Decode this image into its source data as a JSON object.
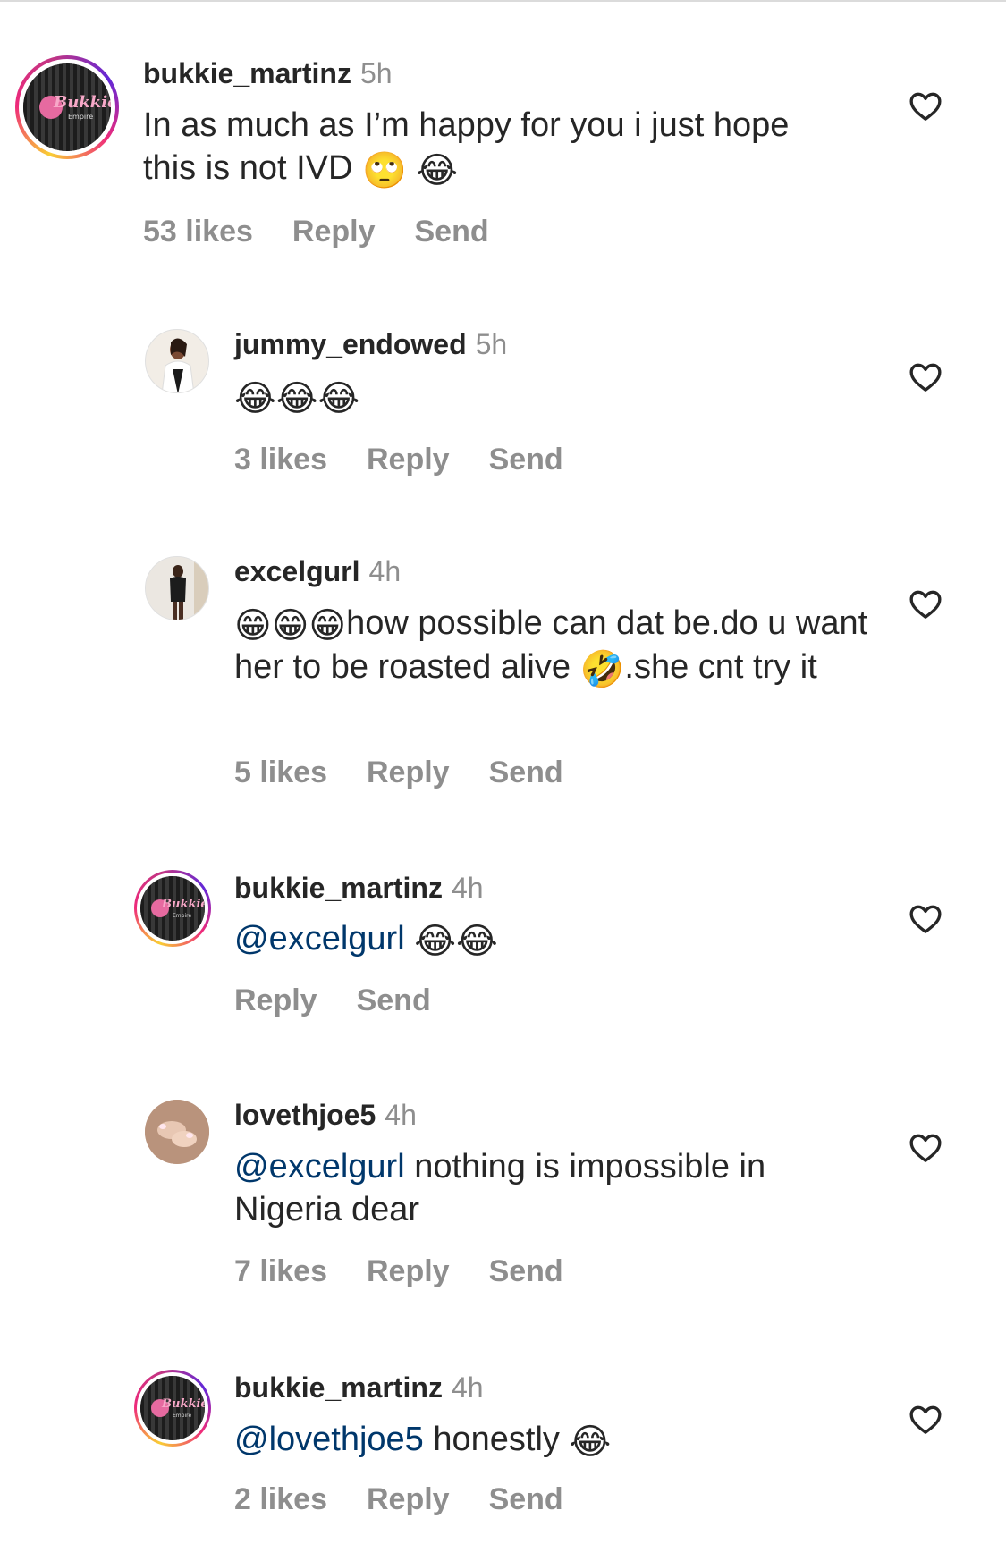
{
  "comments": [
    {
      "username": "bukkie_martinz",
      "time": "5h",
      "text": "In as much as I’m happy for you i just hope this is not IVD",
      "emoji_after": [
        "🙄",
        "😂"
      ],
      "likes": "53 likes",
      "reply": "Reply",
      "send": "Send",
      "avatar_brand": "Bukkie's",
      "avatar_sub": "Empire"
    },
    {
      "username": "jummy_endowed",
      "time": "5h",
      "text": "😂😂😂",
      "likes": "3 likes",
      "reply": "Reply",
      "send": "Send"
    },
    {
      "username": "excelgurl",
      "time": "4h",
      "emoji_before": "😁😁😁",
      "text": "how possible can dat be.do u want her to be roasted alive",
      "emoji_mid": "🤣",
      "text_after": ".she cnt try it",
      "likes": "5 likes",
      "reply": "Reply",
      "send": "Send"
    },
    {
      "username": "bukkie_martinz",
      "time": "4h",
      "mention": "@excelgurl",
      "emoji_after": "😂😂",
      "reply": "Reply",
      "send": "Send",
      "avatar_brand": "Bukkie's",
      "avatar_sub": "Empire"
    },
    {
      "username": "lovethjoe5",
      "time": "4h",
      "mention": "@excelgurl",
      "text": "nothing is impossible in Nigeria dear",
      "likes": "7 likes",
      "reply": "Reply",
      "send": "Send"
    },
    {
      "username": "bukkie_martinz",
      "time": "4h",
      "mention": "@lovethjoe5",
      "text": "honestly",
      "emoji_after": "😂",
      "likes": "2 likes",
      "reply": "Reply",
      "send": "Send",
      "avatar_brand": "Bukkie's",
      "avatar_sub": "Empire"
    }
  ],
  "icons": {
    "like": "heart-outline-icon"
  },
  "colors": {
    "mention": "#00376b",
    "muted": "#8e8e8e",
    "text": "#262626"
  }
}
